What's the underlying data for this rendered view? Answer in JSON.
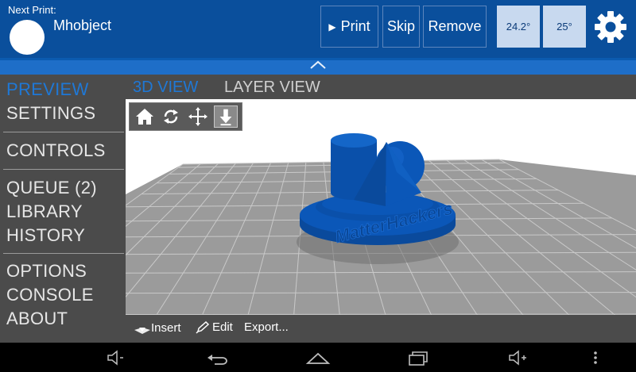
{
  "header": {
    "next_print_label": "Next Print:",
    "next_print_name": "Mhobject",
    "print_label": "Print",
    "skip_label": "Skip",
    "remove_label": "Remove",
    "temp_extruder": "24.2°",
    "temp_bed": "25°"
  },
  "sidebar": {
    "items": [
      {
        "label": "PREVIEW",
        "active": true
      },
      {
        "label": "SETTINGS"
      },
      {
        "label": "CONTROLS"
      },
      {
        "label": "QUEUE (2)"
      },
      {
        "label": "LIBRARY"
      },
      {
        "label": "HISTORY"
      },
      {
        "label": "OPTIONS"
      },
      {
        "label": "CONSOLE"
      },
      {
        "label": "ABOUT"
      }
    ]
  },
  "tabs": [
    {
      "label": "3D VIEW",
      "active": true
    },
    {
      "label": "LAYER VIEW"
    }
  ],
  "model": {
    "embossed_text": "MatterHackers"
  },
  "actions": {
    "insert_label": "Insert",
    "edit_label": "Edit",
    "export_label": "Export..."
  },
  "colors": {
    "header_blue": "#0a4f9c",
    "accent_blue": "#1f78d6",
    "model_blue": "#0b57b8",
    "panel_gray": "#4b4b4b",
    "bed_gray": "#9b9b9b"
  },
  "icons": {
    "view_toolbar": [
      "home-icon",
      "rotate-icon",
      "move-icon",
      "zoom-icon"
    ],
    "navbar": [
      "volume-down-icon",
      "back-icon",
      "home-nav-icon",
      "recent-apps-icon",
      "volume-up-icon",
      "overflow-menu-icon"
    ]
  }
}
